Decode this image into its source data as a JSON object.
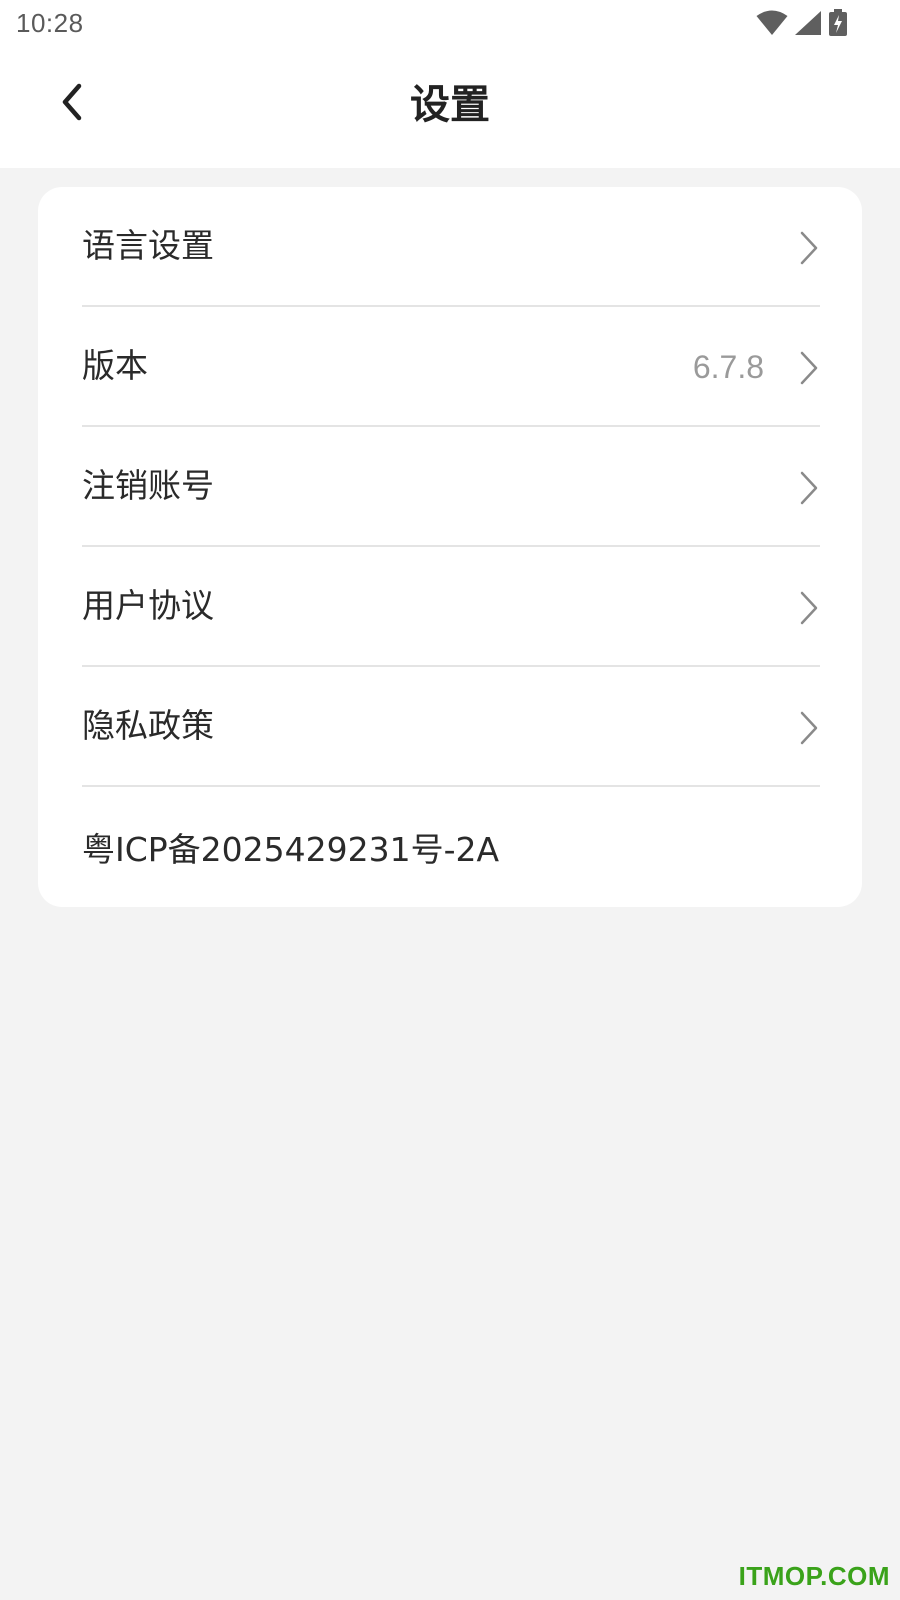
{
  "status_bar": {
    "time": "10:28",
    "icons": [
      "wifi-icon",
      "cellular-signal-icon",
      "battery-charging-icon"
    ]
  },
  "header": {
    "title": "设置",
    "back_icon": "chevron-left-icon"
  },
  "settings": {
    "items": [
      {
        "label": "语言设置",
        "value": ""
      },
      {
        "label": "版本",
        "value": "6.7.8"
      },
      {
        "label": "注销账号",
        "value": ""
      },
      {
        "label": "用户协议",
        "value": ""
      },
      {
        "label": "隐私政策",
        "value": ""
      }
    ],
    "chevron_icon": "chevron-right-icon",
    "icp_text": "粤ICP备2025429231号-2A"
  },
  "watermark": "ITMOP.COM",
  "colors": {
    "background": "#f3f3f3",
    "card": "#ffffff",
    "text": "#222222",
    "muted": "#9a9a9a",
    "divider": "#e4e4e4",
    "watermark": "#3aa21a"
  }
}
